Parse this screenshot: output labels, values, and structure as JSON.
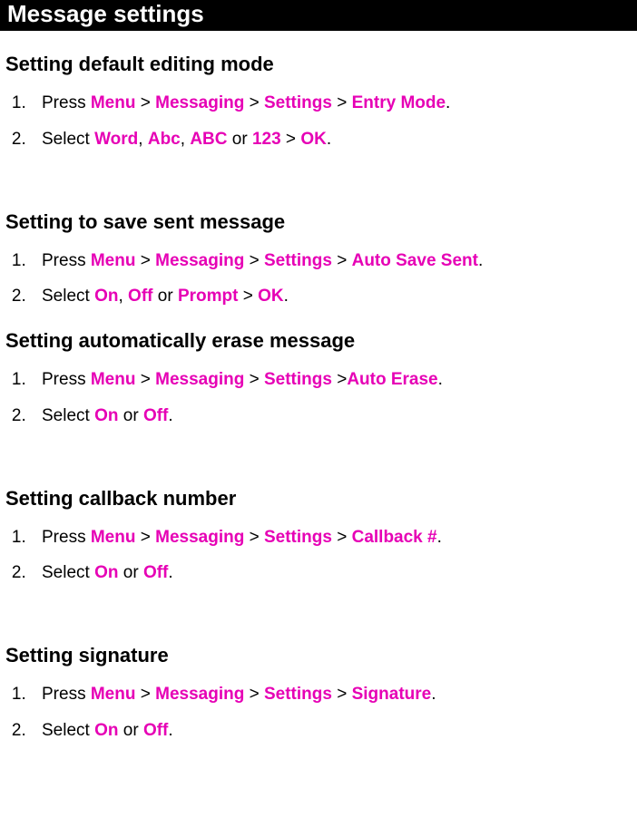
{
  "page": {
    "title": "Message settings"
  },
  "sections": {
    "s1": {
      "heading": "Setting default editing mode",
      "step1": {
        "prefix": "Press ",
        "p1": "Menu",
        "sep": " > ",
        "p2": "Messaging",
        "p3": "Settings",
        "p4": "Entry Mode",
        "suffix": "."
      },
      "step2": {
        "prefix": "Select ",
        "o1": "Word",
        "c1": ", ",
        "o2": "Abc",
        "c2": ", ",
        "o3": "ABC",
        "c3": " or ",
        "o4": "123",
        "gt": " > ",
        "ok": "OK",
        "suffix": "."
      }
    },
    "s2": {
      "heading": "Setting to save sent message",
      "step1": {
        "prefix": "Press ",
        "p1": "Menu",
        "sep": " > ",
        "p2": "Messaging",
        "p3": "Settings",
        "p4": "Auto Save Sent",
        "suffix": "."
      },
      "step2": {
        "prefix": "Select ",
        "o1": "On",
        "c1": ", ",
        "o2": "Off",
        "c2": " or ",
        "o3": "Prompt",
        "gt": " > ",
        "ok": "OK",
        "suffix": "."
      }
    },
    "s3": {
      "heading": "Setting automatically erase message",
      "step1": {
        "prefix": "Press ",
        "p1": "Menu",
        "sep": " > ",
        "p2": "Messaging",
        "p3": "Settings",
        "sep2": " >",
        "p4": "Auto Erase",
        "suffix": "."
      },
      "step2": {
        "prefix": "Select ",
        "o1": "On",
        "c1": " or ",
        "o2": "Off",
        "suffix": "."
      }
    },
    "s4": {
      "heading": "Setting callback number",
      "step1": {
        "prefix": "Press ",
        "p1": "Menu",
        "sep": " > ",
        "p2": "Messaging",
        "p3": "Settings",
        "p4": "Callback #",
        "suffix": "."
      },
      "step2": {
        "prefix": "Select ",
        "o1": "On",
        "c1": " or ",
        "o2": "Off",
        "suffix": "."
      }
    },
    "s5": {
      "heading": "Setting signature",
      "step1": {
        "prefix": "Press ",
        "p1": "Menu",
        "sep": " > ",
        "p2": "Messaging",
        "p3": "Settings",
        "p4": "Signature",
        "suffix": "."
      },
      "step2": {
        "prefix": "Select ",
        "o1": "On",
        "c1": " or ",
        "o2": "Off",
        "suffix": "."
      }
    }
  }
}
